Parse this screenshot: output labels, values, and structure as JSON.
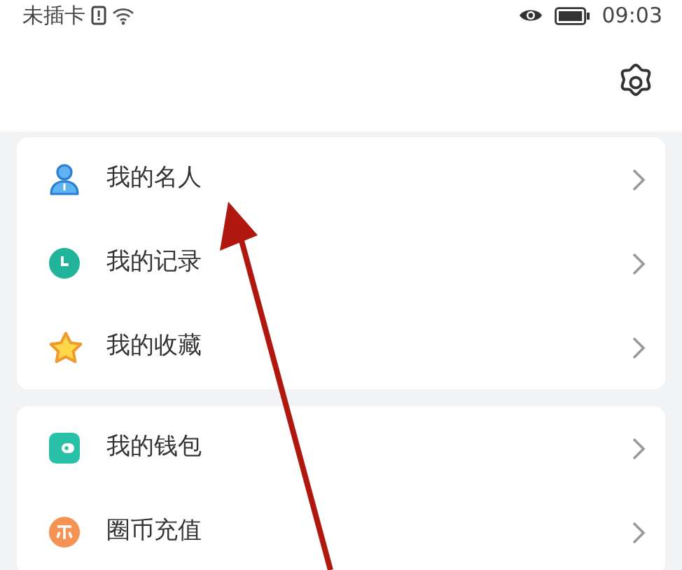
{
  "status_bar": {
    "carrier": "未插卡",
    "time": "09:03"
  },
  "menu_groups": [
    {
      "items": [
        {
          "kind": "person",
          "label": "我的名人"
        },
        {
          "kind": "clock",
          "label": "我的记录"
        },
        {
          "kind": "star",
          "label": "我的收藏"
        }
      ]
    },
    {
      "items": [
        {
          "kind": "wallet",
          "label": "我的钱包"
        },
        {
          "kind": "coin",
          "label": "圈币充值"
        }
      ]
    }
  ]
}
